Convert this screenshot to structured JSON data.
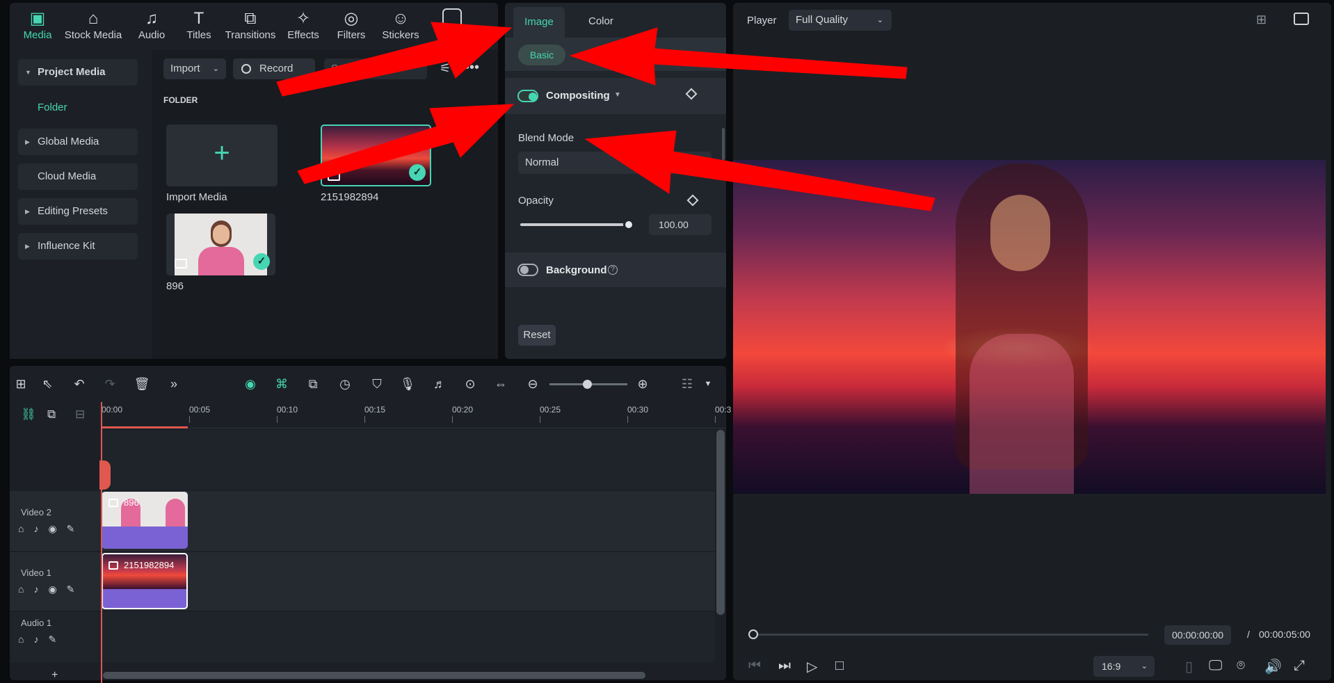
{
  "nav": {
    "items": [
      {
        "label": "Media",
        "icon": "media-icon",
        "glyph": "▣"
      },
      {
        "label": "Stock Media",
        "icon": "stock-media-icon",
        "glyph": "⌂"
      },
      {
        "label": "Audio",
        "icon": "audio-icon",
        "glyph": "♫"
      },
      {
        "label": "Titles",
        "icon": "titles-icon",
        "glyph": "T"
      },
      {
        "label": "Transitions",
        "icon": "transitions-icon",
        "glyph": "⧉"
      },
      {
        "label": "Effects",
        "icon": "effects-icon",
        "glyph": "✧"
      },
      {
        "label": "Filters",
        "icon": "filters-icon",
        "glyph": "◎"
      },
      {
        "label": "Stickers",
        "icon": "stickers-icon",
        "glyph": "☺"
      }
    ],
    "accent": "#46d6b3"
  },
  "sidebar": {
    "items": [
      {
        "label": "Project Media",
        "expanded": true
      },
      {
        "label": "Folder"
      },
      {
        "label": "Global Media"
      },
      {
        "label": "Cloud Media"
      },
      {
        "label": "Editing Presets"
      },
      {
        "label": "Influence Kit"
      }
    ]
  },
  "media": {
    "import_label": "Import",
    "record_label": "Record",
    "search_placeholder": "Search me...",
    "folder_heading": "FOLDER",
    "import_media_label": "Import Media",
    "items": [
      {
        "name": "2151982894"
      },
      {
        "name": "896"
      }
    ]
  },
  "properties": {
    "tabs": [
      "Image",
      "Color"
    ],
    "subtab": "Basic",
    "compositing_label": "Compositing",
    "blend_mode_label": "Blend Mode",
    "blend_mode_value": "Normal",
    "opacity_label": "Opacity",
    "opacity_value": "100.00",
    "opacity_fraction": 1.0,
    "background_label": "Background",
    "reset_label": "Reset"
  },
  "player": {
    "label": "Player",
    "quality": "Full Quality",
    "current_time": "00:00:00:00",
    "separator": "/",
    "total_time": "00:00:05:00",
    "aspect": "16:9"
  },
  "timeline": {
    "ticks": [
      "00:00",
      "00:05",
      "00:10",
      "00:15",
      "00:20",
      "00:25",
      "00:30",
      "00:3"
    ],
    "tracks": [
      {
        "name": "Video 2",
        "clip": "896"
      },
      {
        "name": "Video 1",
        "clip": "2151982894"
      },
      {
        "name": "Audio 1"
      }
    ],
    "add_track": "+"
  }
}
